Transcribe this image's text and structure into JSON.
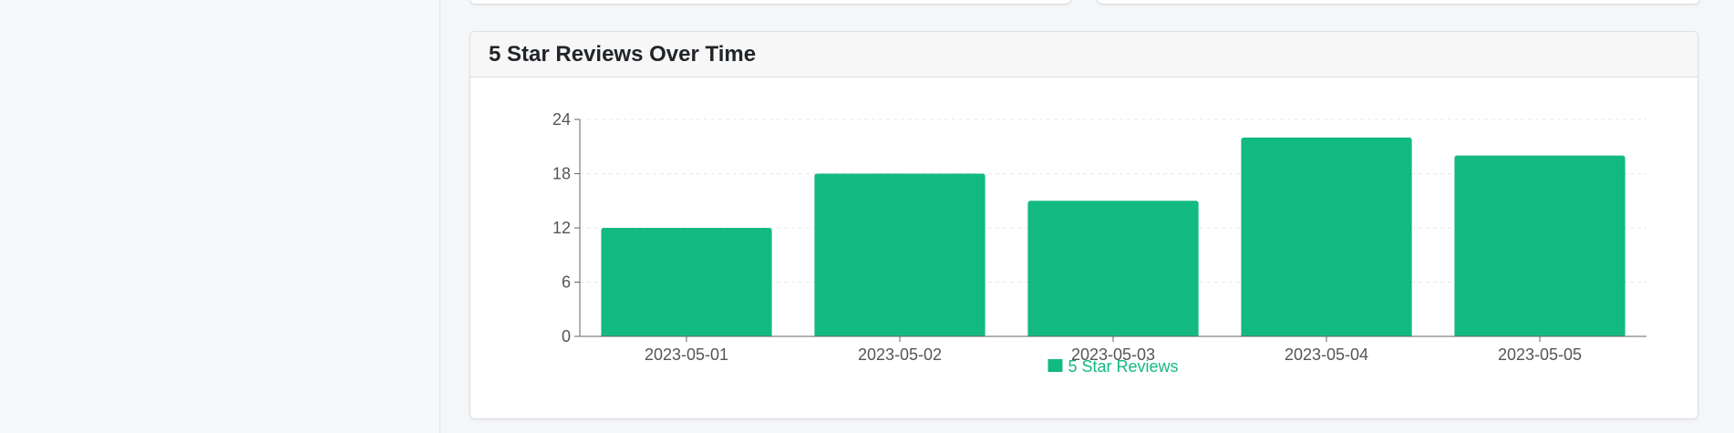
{
  "card": {
    "title": "5 Star Reviews Over Time"
  },
  "colors": {
    "bar": "#12b981",
    "legend_text": "#12b981",
    "axis": "#666666",
    "grid": "#e8e8e8",
    "tick_text": "#555555"
  },
  "chart_data": {
    "type": "bar",
    "categories": [
      "2023-05-01",
      "2023-05-02",
      "2023-05-03",
      "2023-05-04",
      "2023-05-05"
    ],
    "series": [
      {
        "name": "5 Star Reviews",
        "values": [
          12,
          18,
          15,
          22,
          20
        ]
      }
    ],
    "title": "",
    "xlabel": "",
    "ylabel": "",
    "ylim": [
      0,
      24
    ],
    "yticks": [
      0,
      6,
      12,
      18,
      24
    ],
    "grid": true,
    "legend": "bottom-center"
  }
}
